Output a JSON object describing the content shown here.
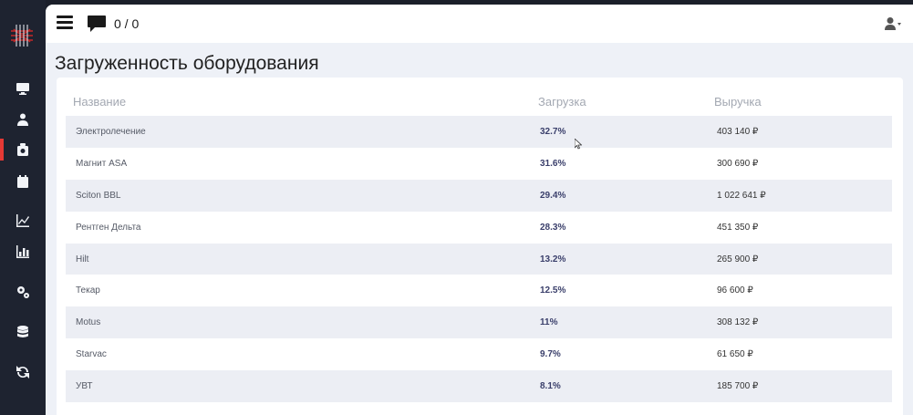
{
  "topbar": {
    "messages": "0 / 0"
  },
  "page": {
    "title": "Загруженность оборудования"
  },
  "table": {
    "headers": {
      "name": "Название",
      "load": "Загрузка",
      "revenue": "Выручка"
    },
    "rows": [
      {
        "name": "Электролечение",
        "load": "32.7%",
        "revenue": "403 140 ₽"
      },
      {
        "name": "Магнит ASA",
        "load": "31.6%",
        "revenue": "300 690 ₽"
      },
      {
        "name": "Sciton BBL",
        "load": "29.4%",
        "revenue": "1 022 641 ₽"
      },
      {
        "name": "Рентген Дельта",
        "load": "28.3%",
        "revenue": "451 350 ₽"
      },
      {
        "name": "Hilt",
        "load": "13.2%",
        "revenue": "265 900 ₽"
      },
      {
        "name": "Текар",
        "load": "12.5%",
        "revenue": "96 600 ₽"
      },
      {
        "name": "Motus",
        "load": "11%",
        "revenue": "308 132 ₽"
      },
      {
        "name": "Starvac",
        "load": "9.7%",
        "revenue": "61 650 ₽"
      },
      {
        "name": "УВТ",
        "load": "8.1%",
        "revenue": "185 700 ₽"
      }
    ]
  },
  "sidebar": {
    "items": [
      {
        "icon": "monitor-icon"
      },
      {
        "icon": "users-icon"
      },
      {
        "icon": "equipment-icon"
      },
      {
        "icon": "calendar-icon"
      },
      {
        "icon": "line-chart-icon"
      },
      {
        "icon": "bar-chart-icon"
      },
      {
        "icon": "gears-icon"
      },
      {
        "icon": "database-icon"
      },
      {
        "icon": "sync-icon"
      }
    ]
  },
  "colors": {
    "accent": "#e53935",
    "sidebar": "#1e2330",
    "row_alt": "#eceef4"
  }
}
